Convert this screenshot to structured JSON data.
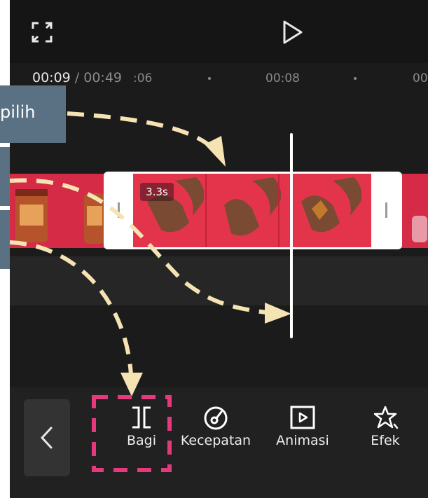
{
  "top": {
    "fullscreen_icon": "fullscreen-icon",
    "play_icon": "play-icon"
  },
  "timecode": {
    "current": "00:09",
    "separator": " / ",
    "total": "00:49"
  },
  "ruler": {
    "tick_left": ":06",
    "tick_mid": "00:08",
    "tick_right": "00"
  },
  "clip": {
    "duration": "3.3s"
  },
  "callout": {
    "label": "pilih"
  },
  "toolbar": {
    "back_icon": "chevron-left-icon",
    "items": [
      {
        "label": "Bagi",
        "icon": "split-icon"
      },
      {
        "label": "Kecepatan",
        "icon": "speed-icon"
      },
      {
        "label": "Animasi",
        "icon": "animation-icon"
      },
      {
        "label": "Efek",
        "icon": "effects-icon"
      }
    ]
  },
  "colors": {
    "background": "#151515",
    "callout": "#5a7184",
    "highlight": "#e6387d",
    "arrow": "#f6e3b4",
    "clip_red": "#d52b46"
  }
}
